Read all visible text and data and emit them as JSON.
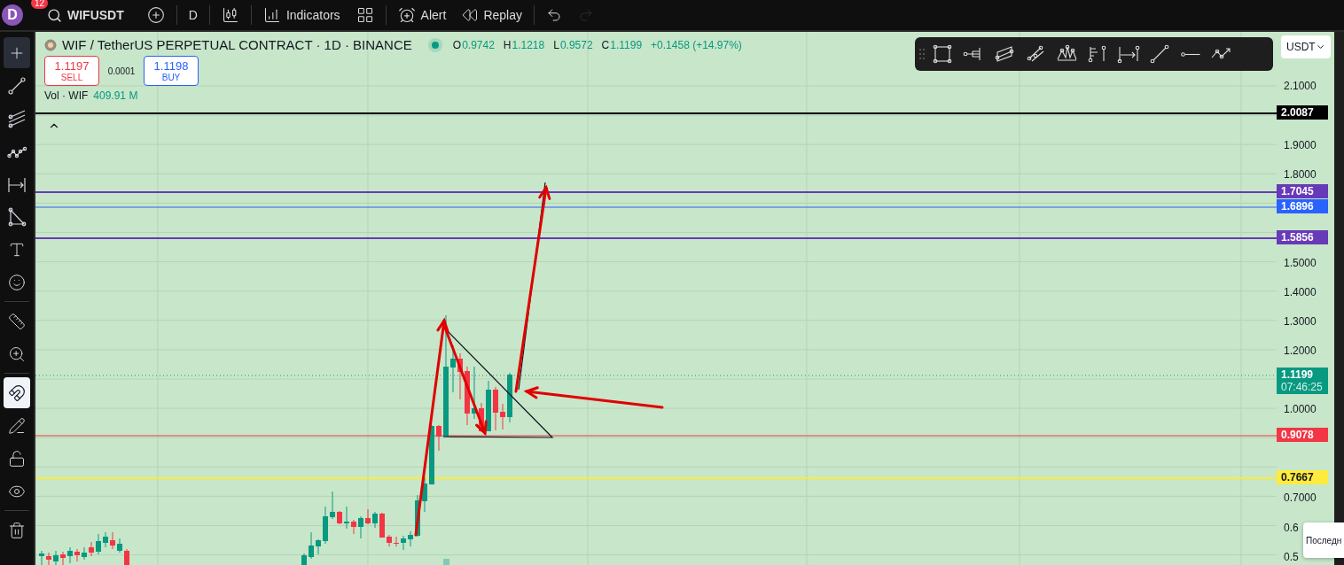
{
  "topbar": {
    "avatar": "D",
    "badge": "12",
    "symbol": "WIFUSDT",
    "interval": "D",
    "items": [
      {
        "kind": "indicators",
        "label": "Indicators"
      },
      {
        "kind": "layouts"
      },
      {
        "kind": "alert",
        "label": "Alert"
      },
      {
        "kind": "replay",
        "label": "Replay"
      },
      {
        "kind": "undo",
        "disabled": false
      },
      {
        "kind": "redo",
        "disabled": true
      }
    ]
  },
  "left_tools": [
    {
      "kind": "cross",
      "selected": true
    },
    {
      "kind": "trend",
      "selected": false
    },
    {
      "kind": "channel",
      "selected": false
    },
    {
      "kind": "wave",
      "selected": false
    },
    {
      "kind": "measure-arrow",
      "selected": false
    },
    {
      "kind": "triangle",
      "selected": false
    },
    {
      "kind": "text",
      "selected": false
    },
    {
      "kind": "emoji",
      "selected": false
    },
    {
      "kind": "divider"
    },
    {
      "kind": "ruler",
      "selected": false
    },
    {
      "kind": "zoom",
      "selected": false
    },
    {
      "kind": "divider"
    },
    {
      "kind": "magnet",
      "selected": true
    },
    {
      "kind": "pencil-lock",
      "selected": false
    },
    {
      "kind": "lock",
      "selected": false
    },
    {
      "kind": "eye",
      "selected": false
    },
    {
      "kind": "divider"
    },
    {
      "kind": "trash",
      "selected": false
    }
  ],
  "legend": {
    "title": "WIF / TetherUS PERPETUAL CONTRACT · 1D · BINANCE",
    "market_open": true,
    "ohlc": [
      {
        "key": "O",
        "value": "0.9742"
      },
      {
        "key": "H",
        "value": "1.1218"
      },
      {
        "key": "L",
        "value": "0.9572"
      },
      {
        "key": "C",
        "value": "1.1199"
      }
    ],
    "change": "+0.1458 (+14.97%)",
    "sell_price": "1.1197",
    "sell_label": "SELL",
    "spread": "0.0001",
    "buy_price": "1.1198",
    "buy_label": "BUY",
    "volume_label": "Vol · WIF",
    "volume_value": "409.91 M"
  },
  "currency": "USDT",
  "price_axis": {
    "ticks": [
      "2.1000",
      "1.9000",
      "1.8000",
      "1.5000",
      "1.4000",
      "1.3000",
      "1.2000",
      "1.0000",
      "0.7000",
      "0.6",
      "0.5"
    ]
  },
  "levels": [
    {
      "price": "2.0087",
      "color": "#000000",
      "kind": "solid"
    },
    {
      "price": "1.7045",
      "color": "#673ab7",
      "kind": "solid"
    },
    {
      "price": "1.6896",
      "color": "#2962ff",
      "kind": "thin"
    },
    {
      "price": "1.5856",
      "color": "#673ab7",
      "kind": "solid"
    },
    {
      "price": "1.1199",
      "countdown": "07:46:25",
      "color": "#089981",
      "kind": "dotted"
    },
    {
      "price": "0.9078",
      "color": "#f23645",
      "kind": "thin"
    },
    {
      "price": "0.7667",
      "color": "#ffeb3b",
      "kind": "solid"
    }
  ],
  "popup": {
    "text": "Последн"
  }
}
